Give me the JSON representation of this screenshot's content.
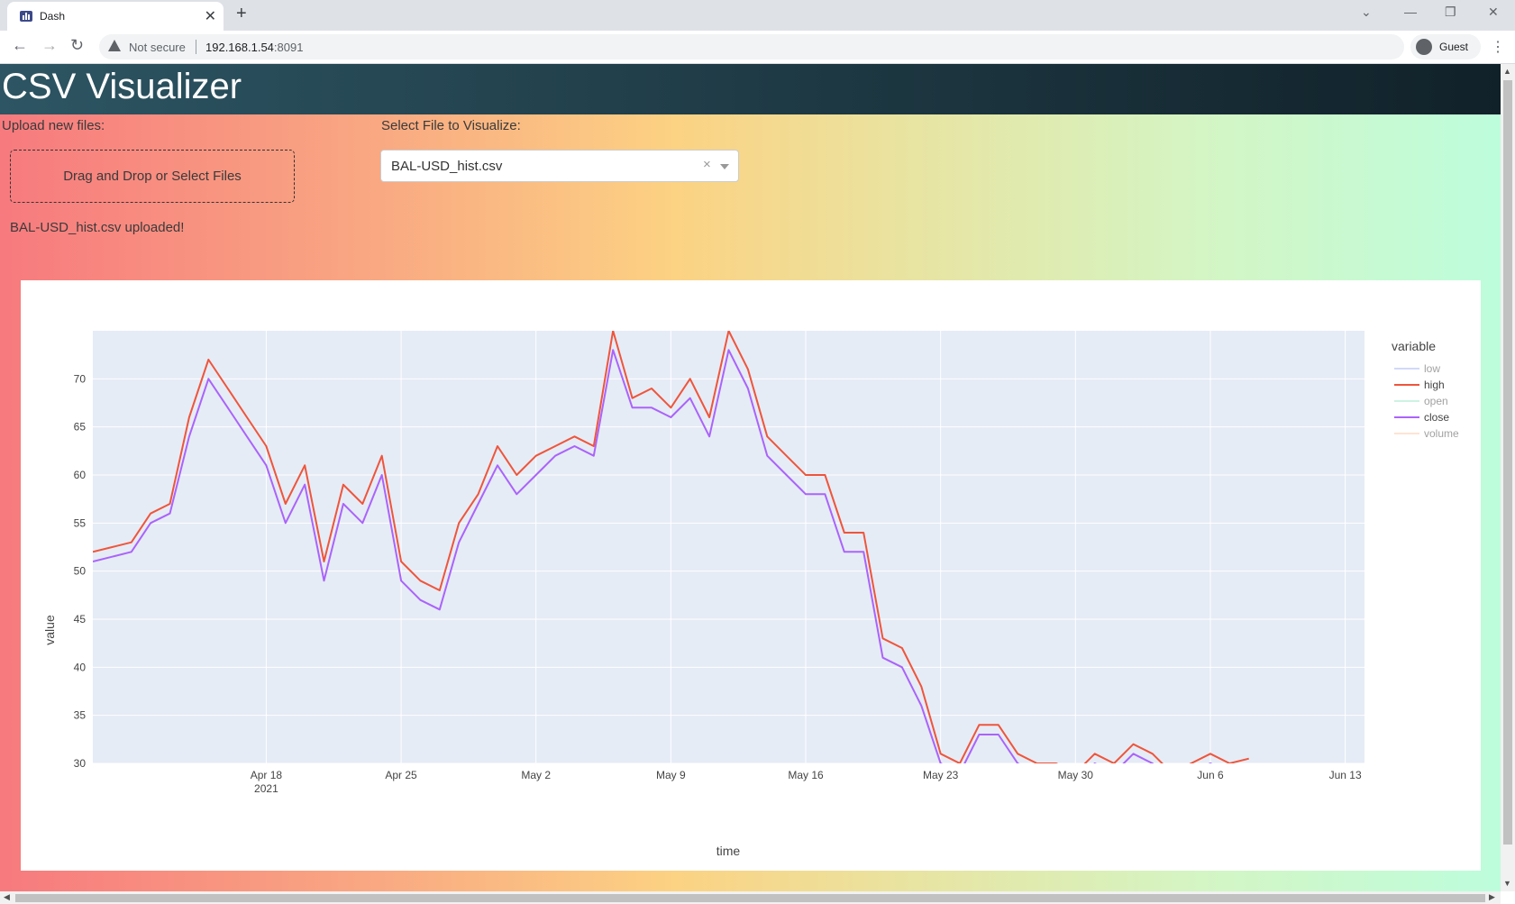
{
  "browser": {
    "tab_title": "Dash",
    "not_secure": "Not secure",
    "url_host": "192.168.1.54",
    "url_port": ":8091",
    "profile": "Guest"
  },
  "app": {
    "title": "CSV Visualizer",
    "upload_label": "Upload new files:",
    "dropzone_text": "Drag and Drop or Select Files",
    "upload_status": "BAL-USD_hist.csv uploaded!",
    "select_label": "Select File to Visualize:",
    "select_value": "BAL-USD_hist.csv",
    "select_clear": "×"
  },
  "colors": {
    "low": "#a7b4f5",
    "high": "#ef553b",
    "open": "#9de6c9",
    "close": "#ab63fa",
    "volume": "#ffc9a8",
    "plot_bg": "#e5ecf6"
  },
  "chart_data": {
    "type": "line",
    "xlabel": "time",
    "ylabel": "value",
    "legend_title": "variable",
    "legend_position": "right",
    "grid": true,
    "ylim": [
      30,
      75
    ],
    "xlim": [
      "2021-04-09",
      "2021-06-14"
    ],
    "x_ticks": [
      "Apr 18",
      "Apr 25",
      "May 2",
      "May 9",
      "May 16",
      "May 23",
      "May 30",
      "Jun 6",
      "Jun 13"
    ],
    "x_tick_sub": "2021",
    "y_ticks": [
      30,
      35,
      40,
      45,
      50,
      55,
      60,
      65,
      70
    ],
    "series": [
      {
        "name": "low",
        "visible": false
      },
      {
        "name": "high",
        "visible": true,
        "x": [
          "2021-04-09",
          "2021-04-10",
          "2021-04-11",
          "2021-04-12",
          "2021-04-13",
          "2021-04-14",
          "2021-04-15",
          "2021-04-16",
          "2021-04-17",
          "2021-04-18",
          "2021-04-19",
          "2021-04-20",
          "2021-04-21",
          "2021-04-22",
          "2021-04-23",
          "2021-04-24",
          "2021-04-25",
          "2021-04-26",
          "2021-04-27",
          "2021-04-28",
          "2021-04-29",
          "2021-04-30",
          "2021-05-01",
          "2021-05-02",
          "2021-05-03",
          "2021-05-04",
          "2021-05-05",
          "2021-05-06",
          "2021-05-07",
          "2021-05-08",
          "2021-05-09",
          "2021-05-10",
          "2021-05-11",
          "2021-05-12",
          "2021-05-13",
          "2021-05-14",
          "2021-05-15",
          "2021-05-16",
          "2021-05-17",
          "2021-05-18",
          "2021-05-19",
          "2021-05-20",
          "2021-05-21",
          "2021-05-22",
          "2021-05-23",
          "2021-05-24",
          "2021-05-25",
          "2021-05-26",
          "2021-05-27",
          "2021-05-28",
          "2021-05-29",
          "2021-05-30",
          "2021-05-31",
          "2021-06-01",
          "2021-06-02",
          "2021-06-03",
          "2021-06-04",
          "2021-06-05",
          "2021-06-06",
          "2021-06-07",
          "2021-06-08"
        ],
        "y": [
          52,
          52.5,
          53,
          56,
          57,
          66,
          72,
          69,
          66,
          63,
          57,
          61,
          51,
          59,
          57,
          62,
          51,
          49,
          48,
          55,
          58,
          63,
          60,
          62,
          63,
          64,
          63,
          75,
          68,
          69,
          67,
          70,
          66,
          75,
          71,
          64,
          62,
          60,
          60,
          54,
          54,
          43,
          42,
          38,
          31,
          30,
          34,
          34,
          31,
          30,
          30,
          29,
          31,
          30,
          32,
          31,
          29,
          30,
          31,
          30,
          30.5
        ]
      },
      {
        "name": "open",
        "visible": false
      },
      {
        "name": "close",
        "visible": true,
        "x": [
          "2021-04-09",
          "2021-04-10",
          "2021-04-11",
          "2021-04-12",
          "2021-04-13",
          "2021-04-14",
          "2021-04-15",
          "2021-04-16",
          "2021-04-17",
          "2021-04-18",
          "2021-04-19",
          "2021-04-20",
          "2021-04-21",
          "2021-04-22",
          "2021-04-23",
          "2021-04-24",
          "2021-04-25",
          "2021-04-26",
          "2021-04-27",
          "2021-04-28",
          "2021-04-29",
          "2021-04-30",
          "2021-05-01",
          "2021-05-02",
          "2021-05-03",
          "2021-05-04",
          "2021-05-05",
          "2021-05-06",
          "2021-05-07",
          "2021-05-08",
          "2021-05-09",
          "2021-05-10",
          "2021-05-11",
          "2021-05-12",
          "2021-05-13",
          "2021-05-14",
          "2021-05-15",
          "2021-05-16",
          "2021-05-17",
          "2021-05-18",
          "2021-05-19",
          "2021-05-20",
          "2021-05-21",
          "2021-05-22",
          "2021-05-23",
          "2021-05-24",
          "2021-05-25",
          "2021-05-26",
          "2021-05-27",
          "2021-05-28",
          "2021-05-29",
          "2021-05-30",
          "2021-05-31",
          "2021-06-01",
          "2021-06-02",
          "2021-06-03",
          "2021-06-04",
          "2021-06-05",
          "2021-06-06",
          "2021-06-07",
          "2021-06-08"
        ],
        "y": [
          51,
          51.5,
          52,
          55,
          56,
          64,
          70,
          67,
          64,
          61,
          55,
          59,
          49,
          57,
          55,
          60,
          49,
          47,
          46,
          53,
          57,
          61,
          58,
          60,
          62,
          63,
          62,
          73,
          67,
          67,
          66,
          68,
          64,
          73,
          69,
          62,
          60,
          58,
          58,
          52,
          52,
          41,
          40,
          36,
          30,
          29,
          33,
          33,
          30,
          29,
          29,
          28,
          30,
          29,
          31,
          30,
          28,
          29,
          30,
          29,
          29.5
        ]
      },
      {
        "name": "volume",
        "visible": false
      }
    ]
  }
}
